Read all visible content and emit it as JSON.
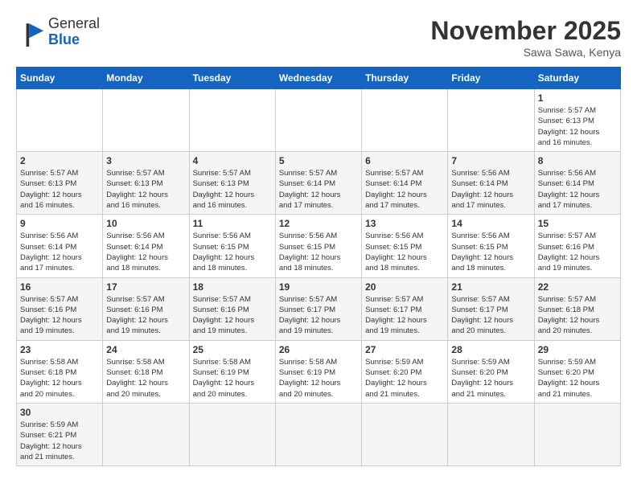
{
  "header": {
    "logo_general": "General",
    "logo_blue": "Blue",
    "month_title": "November 2025",
    "location": "Sawa Sawa, Kenya"
  },
  "weekdays": [
    "Sunday",
    "Monday",
    "Tuesday",
    "Wednesday",
    "Thursday",
    "Friday",
    "Saturday"
  ],
  "weeks": [
    [
      {
        "day": null,
        "info": null
      },
      {
        "day": null,
        "info": null
      },
      {
        "day": null,
        "info": null
      },
      {
        "day": null,
        "info": null
      },
      {
        "day": null,
        "info": null
      },
      {
        "day": null,
        "info": null
      },
      {
        "day": "1",
        "info": "Sunrise: 5:57 AM\nSunset: 6:13 PM\nDaylight: 12 hours\nand 16 minutes."
      }
    ],
    [
      {
        "day": "2",
        "info": "Sunrise: 5:57 AM\nSunset: 6:13 PM\nDaylight: 12 hours\nand 16 minutes."
      },
      {
        "day": "3",
        "info": "Sunrise: 5:57 AM\nSunset: 6:13 PM\nDaylight: 12 hours\nand 16 minutes."
      },
      {
        "day": "4",
        "info": "Sunrise: 5:57 AM\nSunset: 6:13 PM\nDaylight: 12 hours\nand 16 minutes."
      },
      {
        "day": "5",
        "info": "Sunrise: 5:57 AM\nSunset: 6:14 PM\nDaylight: 12 hours\nand 17 minutes."
      },
      {
        "day": "6",
        "info": "Sunrise: 5:57 AM\nSunset: 6:14 PM\nDaylight: 12 hours\nand 17 minutes."
      },
      {
        "day": "7",
        "info": "Sunrise: 5:56 AM\nSunset: 6:14 PM\nDaylight: 12 hours\nand 17 minutes."
      },
      {
        "day": "8",
        "info": "Sunrise: 5:56 AM\nSunset: 6:14 PM\nDaylight: 12 hours\nand 17 minutes."
      }
    ],
    [
      {
        "day": "9",
        "info": "Sunrise: 5:56 AM\nSunset: 6:14 PM\nDaylight: 12 hours\nand 17 minutes."
      },
      {
        "day": "10",
        "info": "Sunrise: 5:56 AM\nSunset: 6:14 PM\nDaylight: 12 hours\nand 18 minutes."
      },
      {
        "day": "11",
        "info": "Sunrise: 5:56 AM\nSunset: 6:15 PM\nDaylight: 12 hours\nand 18 minutes."
      },
      {
        "day": "12",
        "info": "Sunrise: 5:56 AM\nSunset: 6:15 PM\nDaylight: 12 hours\nand 18 minutes."
      },
      {
        "day": "13",
        "info": "Sunrise: 5:56 AM\nSunset: 6:15 PM\nDaylight: 12 hours\nand 18 minutes."
      },
      {
        "day": "14",
        "info": "Sunrise: 5:56 AM\nSunset: 6:15 PM\nDaylight: 12 hours\nand 18 minutes."
      },
      {
        "day": "15",
        "info": "Sunrise: 5:57 AM\nSunset: 6:16 PM\nDaylight: 12 hours\nand 19 minutes."
      }
    ],
    [
      {
        "day": "16",
        "info": "Sunrise: 5:57 AM\nSunset: 6:16 PM\nDaylight: 12 hours\nand 19 minutes."
      },
      {
        "day": "17",
        "info": "Sunrise: 5:57 AM\nSunset: 6:16 PM\nDaylight: 12 hours\nand 19 minutes."
      },
      {
        "day": "18",
        "info": "Sunrise: 5:57 AM\nSunset: 6:16 PM\nDaylight: 12 hours\nand 19 minutes."
      },
      {
        "day": "19",
        "info": "Sunrise: 5:57 AM\nSunset: 6:17 PM\nDaylight: 12 hours\nand 19 minutes."
      },
      {
        "day": "20",
        "info": "Sunrise: 5:57 AM\nSunset: 6:17 PM\nDaylight: 12 hours\nand 19 minutes."
      },
      {
        "day": "21",
        "info": "Sunrise: 5:57 AM\nSunset: 6:17 PM\nDaylight: 12 hours\nand 20 minutes."
      },
      {
        "day": "22",
        "info": "Sunrise: 5:57 AM\nSunset: 6:18 PM\nDaylight: 12 hours\nand 20 minutes."
      }
    ],
    [
      {
        "day": "23",
        "info": "Sunrise: 5:58 AM\nSunset: 6:18 PM\nDaylight: 12 hours\nand 20 minutes."
      },
      {
        "day": "24",
        "info": "Sunrise: 5:58 AM\nSunset: 6:18 PM\nDaylight: 12 hours\nand 20 minutes."
      },
      {
        "day": "25",
        "info": "Sunrise: 5:58 AM\nSunset: 6:19 PM\nDaylight: 12 hours\nand 20 minutes."
      },
      {
        "day": "26",
        "info": "Sunrise: 5:58 AM\nSunset: 6:19 PM\nDaylight: 12 hours\nand 20 minutes."
      },
      {
        "day": "27",
        "info": "Sunrise: 5:59 AM\nSunset: 6:20 PM\nDaylight: 12 hours\nand 21 minutes."
      },
      {
        "day": "28",
        "info": "Sunrise: 5:59 AM\nSunset: 6:20 PM\nDaylight: 12 hours\nand 21 minutes."
      },
      {
        "day": "29",
        "info": "Sunrise: 5:59 AM\nSunset: 6:20 PM\nDaylight: 12 hours\nand 21 minutes."
      }
    ],
    [
      {
        "day": "30",
        "info": "Sunrise: 5:59 AM\nSunset: 6:21 PM\nDaylight: 12 hours\nand 21 minutes."
      },
      {
        "day": null,
        "info": null
      },
      {
        "day": null,
        "info": null
      },
      {
        "day": null,
        "info": null
      },
      {
        "day": null,
        "info": null
      },
      {
        "day": null,
        "info": null
      },
      {
        "day": null,
        "info": null
      }
    ]
  ]
}
